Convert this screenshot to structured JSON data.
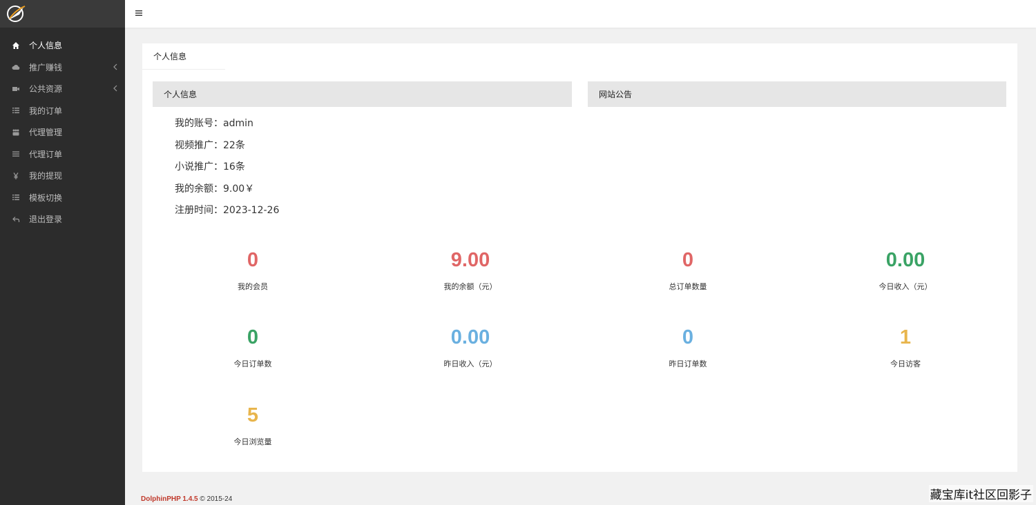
{
  "sidebar": {
    "items": [
      {
        "label": "个人信息",
        "icon": "home-icon",
        "active": true
      },
      {
        "label": "推广赚钱",
        "icon": "cloud-icon",
        "expandable": true
      },
      {
        "label": "公共资源",
        "icon": "video-icon",
        "expandable": true
      },
      {
        "label": "我的订单",
        "icon": "list-icon"
      },
      {
        "label": "代理管理",
        "icon": "users-icon"
      },
      {
        "label": "代理订单",
        "icon": "lines-icon"
      },
      {
        "label": "我的提现",
        "icon": "yen-icon"
      },
      {
        "label": "模板切换",
        "icon": "list-icon"
      },
      {
        "label": "退出登录",
        "icon": "logout-icon"
      }
    ]
  },
  "main": {
    "card_title": "个人信息",
    "left_panel_title": "个人信息",
    "right_panel_title": "网站公告",
    "info": [
      "我的账号：admin",
      "视频推广：22条",
      "小说推广：16条",
      "我的余额：9.00￥",
      "注册时间：2023-12-26"
    ],
    "stats": [
      {
        "value": "0",
        "label": "我的会员",
        "color": "#e06666"
      },
      {
        "value": "9.00",
        "label": "我的余额（元）",
        "color": "#e06666"
      },
      {
        "value": "0",
        "label": "总订单数量",
        "color": "#e06666"
      },
      {
        "value": "0.00",
        "label": "今日收入（元）",
        "color": "#3aa365"
      },
      {
        "value": "0",
        "label": "今日订单数",
        "color": "#3aa365"
      },
      {
        "value": "0.00",
        "label": "昨日收入（元）",
        "color": "#6ab0e0"
      },
      {
        "value": "0",
        "label": "昨日订单数",
        "color": "#6ab0e0"
      },
      {
        "value": "1",
        "label": "今日访客",
        "color": "#e8b54d"
      },
      {
        "value": "5",
        "label": "今日浏览量",
        "color": "#e8b54d"
      }
    ]
  },
  "footer": {
    "brand": "DolphinPHP 1.4.5",
    "copyright": "© 2015-24"
  },
  "watermark": "藏宝库it社区回影子"
}
